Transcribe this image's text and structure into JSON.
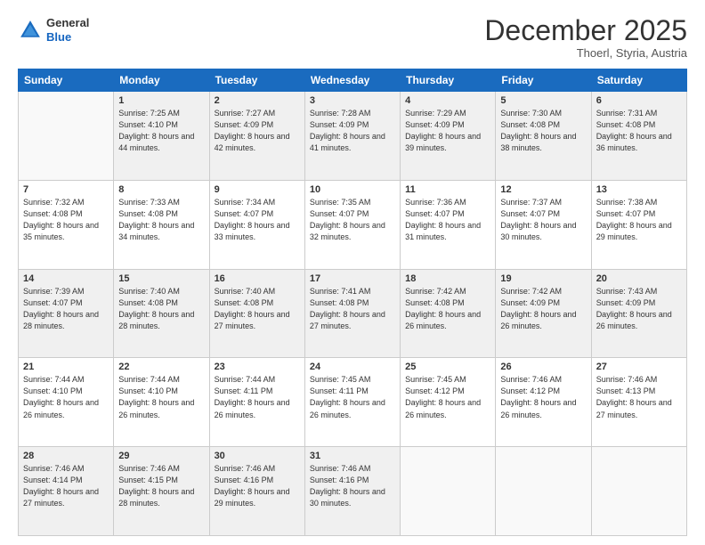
{
  "header": {
    "logo_line1": "General",
    "logo_line2": "Blue",
    "month": "December 2025",
    "location": "Thoerl, Styria, Austria"
  },
  "weekdays": [
    "Sunday",
    "Monday",
    "Tuesday",
    "Wednesday",
    "Thursday",
    "Friday",
    "Saturday"
  ],
  "rows": [
    [
      {
        "day": "",
        "empty": true
      },
      {
        "day": "1",
        "sunrise": "Sunrise: 7:25 AM",
        "sunset": "Sunset: 4:10 PM",
        "daylight": "Daylight: 8 hours and 44 minutes."
      },
      {
        "day": "2",
        "sunrise": "Sunrise: 7:27 AM",
        "sunset": "Sunset: 4:09 PM",
        "daylight": "Daylight: 8 hours and 42 minutes."
      },
      {
        "day": "3",
        "sunrise": "Sunrise: 7:28 AM",
        "sunset": "Sunset: 4:09 PM",
        "daylight": "Daylight: 8 hours and 41 minutes."
      },
      {
        "day": "4",
        "sunrise": "Sunrise: 7:29 AM",
        "sunset": "Sunset: 4:09 PM",
        "daylight": "Daylight: 8 hours and 39 minutes."
      },
      {
        "day": "5",
        "sunrise": "Sunrise: 7:30 AM",
        "sunset": "Sunset: 4:08 PM",
        "daylight": "Daylight: 8 hours and 38 minutes."
      },
      {
        "day": "6",
        "sunrise": "Sunrise: 7:31 AM",
        "sunset": "Sunset: 4:08 PM",
        "daylight": "Daylight: 8 hours and 36 minutes."
      }
    ],
    [
      {
        "day": "7",
        "sunrise": "Sunrise: 7:32 AM",
        "sunset": "Sunset: 4:08 PM",
        "daylight": "Daylight: 8 hours and 35 minutes."
      },
      {
        "day": "8",
        "sunrise": "Sunrise: 7:33 AM",
        "sunset": "Sunset: 4:08 PM",
        "daylight": "Daylight: 8 hours and 34 minutes."
      },
      {
        "day": "9",
        "sunrise": "Sunrise: 7:34 AM",
        "sunset": "Sunset: 4:07 PM",
        "daylight": "Daylight: 8 hours and 33 minutes."
      },
      {
        "day": "10",
        "sunrise": "Sunrise: 7:35 AM",
        "sunset": "Sunset: 4:07 PM",
        "daylight": "Daylight: 8 hours and 32 minutes."
      },
      {
        "day": "11",
        "sunrise": "Sunrise: 7:36 AM",
        "sunset": "Sunset: 4:07 PM",
        "daylight": "Daylight: 8 hours and 31 minutes."
      },
      {
        "day": "12",
        "sunrise": "Sunrise: 7:37 AM",
        "sunset": "Sunset: 4:07 PM",
        "daylight": "Daylight: 8 hours and 30 minutes."
      },
      {
        "day": "13",
        "sunrise": "Sunrise: 7:38 AM",
        "sunset": "Sunset: 4:07 PM",
        "daylight": "Daylight: 8 hours and 29 minutes."
      }
    ],
    [
      {
        "day": "14",
        "sunrise": "Sunrise: 7:39 AM",
        "sunset": "Sunset: 4:07 PM",
        "daylight": "Daylight: 8 hours and 28 minutes."
      },
      {
        "day": "15",
        "sunrise": "Sunrise: 7:40 AM",
        "sunset": "Sunset: 4:08 PM",
        "daylight": "Daylight: 8 hours and 28 minutes."
      },
      {
        "day": "16",
        "sunrise": "Sunrise: 7:40 AM",
        "sunset": "Sunset: 4:08 PM",
        "daylight": "Daylight: 8 hours and 27 minutes."
      },
      {
        "day": "17",
        "sunrise": "Sunrise: 7:41 AM",
        "sunset": "Sunset: 4:08 PM",
        "daylight": "Daylight: 8 hours and 27 minutes."
      },
      {
        "day": "18",
        "sunrise": "Sunrise: 7:42 AM",
        "sunset": "Sunset: 4:08 PM",
        "daylight": "Daylight: 8 hours and 26 minutes."
      },
      {
        "day": "19",
        "sunrise": "Sunrise: 7:42 AM",
        "sunset": "Sunset: 4:09 PM",
        "daylight": "Daylight: 8 hours and 26 minutes."
      },
      {
        "day": "20",
        "sunrise": "Sunrise: 7:43 AM",
        "sunset": "Sunset: 4:09 PM",
        "daylight": "Daylight: 8 hours and 26 minutes."
      }
    ],
    [
      {
        "day": "21",
        "sunrise": "Sunrise: 7:44 AM",
        "sunset": "Sunset: 4:10 PM",
        "daylight": "Daylight: 8 hours and 26 minutes."
      },
      {
        "day": "22",
        "sunrise": "Sunrise: 7:44 AM",
        "sunset": "Sunset: 4:10 PM",
        "daylight": "Daylight: 8 hours and 26 minutes."
      },
      {
        "day": "23",
        "sunrise": "Sunrise: 7:44 AM",
        "sunset": "Sunset: 4:11 PM",
        "daylight": "Daylight: 8 hours and 26 minutes."
      },
      {
        "day": "24",
        "sunrise": "Sunrise: 7:45 AM",
        "sunset": "Sunset: 4:11 PM",
        "daylight": "Daylight: 8 hours and 26 minutes."
      },
      {
        "day": "25",
        "sunrise": "Sunrise: 7:45 AM",
        "sunset": "Sunset: 4:12 PM",
        "daylight": "Daylight: 8 hours and 26 minutes."
      },
      {
        "day": "26",
        "sunrise": "Sunrise: 7:46 AM",
        "sunset": "Sunset: 4:12 PM",
        "daylight": "Daylight: 8 hours and 26 minutes."
      },
      {
        "day": "27",
        "sunrise": "Sunrise: 7:46 AM",
        "sunset": "Sunset: 4:13 PM",
        "daylight": "Daylight: 8 hours and 27 minutes."
      }
    ],
    [
      {
        "day": "28",
        "sunrise": "Sunrise: 7:46 AM",
        "sunset": "Sunset: 4:14 PM",
        "daylight": "Daylight: 8 hours and 27 minutes."
      },
      {
        "day": "29",
        "sunrise": "Sunrise: 7:46 AM",
        "sunset": "Sunset: 4:15 PM",
        "daylight": "Daylight: 8 hours and 28 minutes."
      },
      {
        "day": "30",
        "sunrise": "Sunrise: 7:46 AM",
        "sunset": "Sunset: 4:16 PM",
        "daylight": "Daylight: 8 hours and 29 minutes."
      },
      {
        "day": "31",
        "sunrise": "Sunrise: 7:46 AM",
        "sunset": "Sunset: 4:16 PM",
        "daylight": "Daylight: 8 hours and 30 minutes."
      },
      {
        "day": "",
        "empty": true
      },
      {
        "day": "",
        "empty": true
      },
      {
        "day": "",
        "empty": true
      }
    ]
  ]
}
